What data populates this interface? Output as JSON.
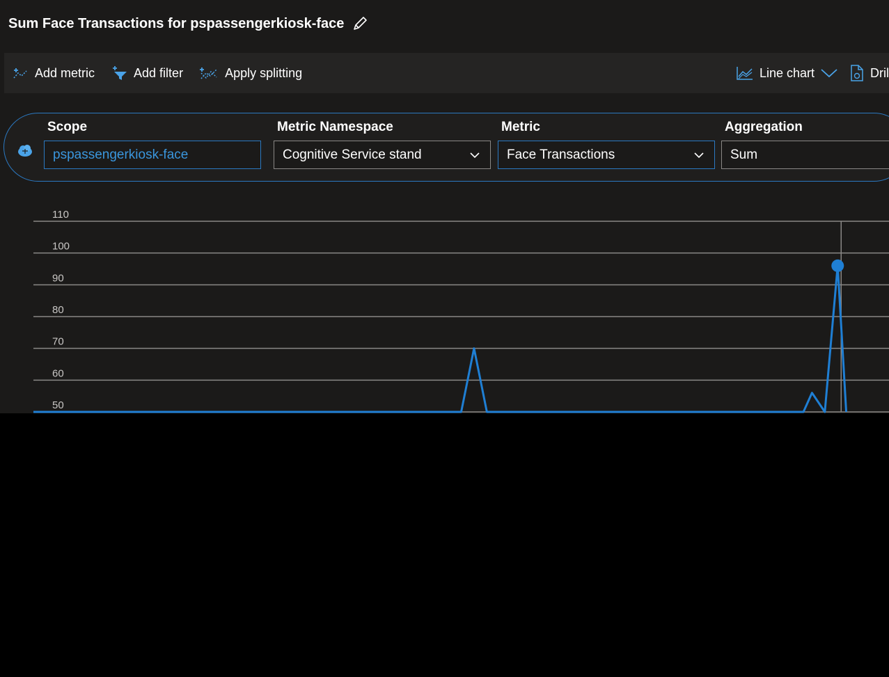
{
  "header": {
    "title": "Sum Face Transactions for pspassengerkiosk-face",
    "edit_icon": "pencil-icon"
  },
  "toolbar": {
    "add_metric": "Add metric",
    "add_filter": "Add filter",
    "apply_splitting": "Apply splitting",
    "chart_type": "Line chart",
    "drill": "Dril"
  },
  "metric_selector": {
    "scope_label": "Scope",
    "scope_value": "pspassengerkiosk-face",
    "namespace_label": "Metric Namespace",
    "namespace_value": "Cognitive Service stand",
    "metric_label": "Metric",
    "metric_value": "Face Transactions",
    "aggregation_label": "Aggregation",
    "aggregation_value": "Sum"
  },
  "colors": {
    "accent": "#2b79c2",
    "series": "#1f7fd4",
    "background": "#1b1a19"
  },
  "chart_data": {
    "type": "line",
    "y_ticks": [
      110,
      100,
      90,
      80,
      70,
      60,
      50
    ],
    "ylim": [
      50,
      110
    ],
    "grid": true,
    "series": [
      {
        "x": [
          0.0,
          0.5,
          0.515,
          0.53,
          0.9,
          0.91,
          0.925,
          0.94,
          0.95
        ],
        "y": [
          50,
          50,
          70,
          50,
          50,
          56,
          50,
          96,
          50
        ]
      }
    ],
    "highlight": {
      "x": 0.94,
      "y": 96
    }
  }
}
